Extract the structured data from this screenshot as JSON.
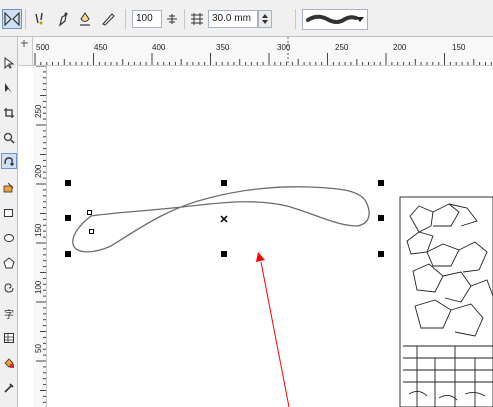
{
  "property_bar": {
    "tools": [
      {
        "name": "mirror-icon"
      },
      {
        "name": "freehand-smoothing-icon"
      },
      {
        "name": "brush-stroke-icon"
      },
      {
        "name": "sprayer-icon"
      },
      {
        "name": "calligraphic-pen-icon"
      }
    ],
    "smoothing_value": "100",
    "width_value": "30.0 mm",
    "stroke_preset_icon": "brush-stroke-preset"
  },
  "toolbox": {
    "tools": [
      "pick-tool",
      "shape-tool",
      "crop-tool",
      "zoom-tool",
      "artistic-media-tool",
      "smart-fill-tool",
      "rectangle-tool",
      "ellipse-tool",
      "polygon-tool",
      "spiral-tool",
      "text-tool",
      "table-tool",
      "interactive-fill-tool",
      "eyedropper-tool"
    ],
    "active_tool": "artistic-media-tool",
    "text_tool_glyph": "字"
  },
  "rulers": {
    "horizontal_labels": [
      "500",
      "450",
      "400",
      "350",
      "300",
      "250",
      "200",
      "150"
    ],
    "vertical_labels": [
      "250",
      "200",
      "150",
      "100",
      "50"
    ]
  },
  "annotation": {
    "arrow_color": "#ff0000"
  }
}
